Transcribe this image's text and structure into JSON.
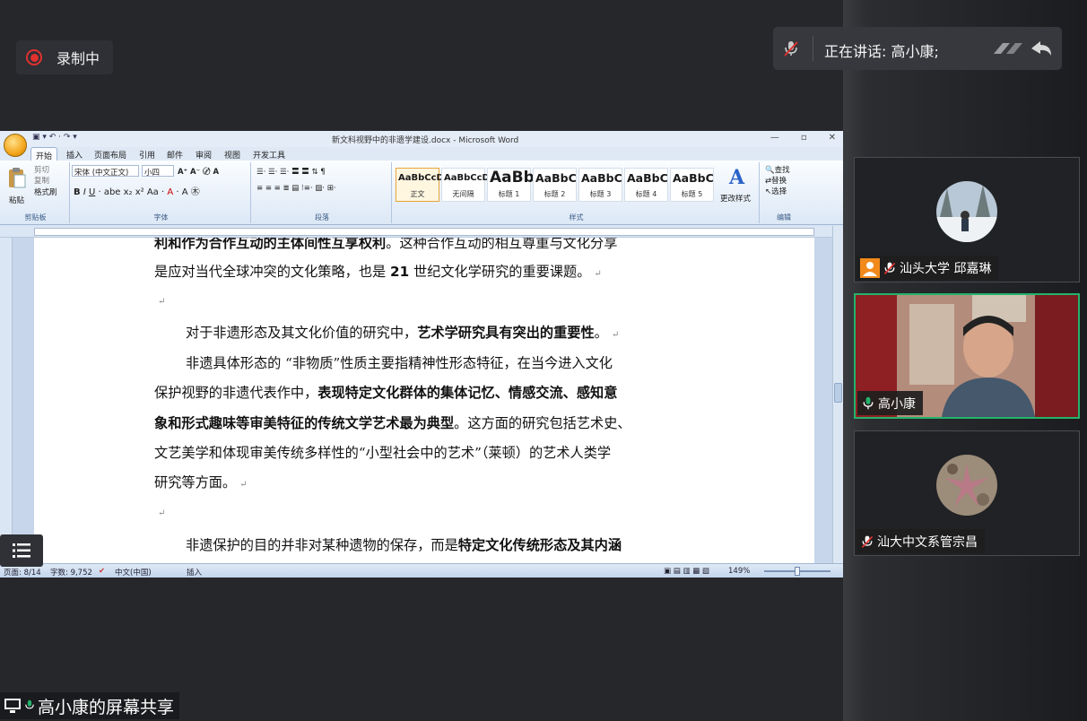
{
  "meeting": {
    "recording_label": "录制中",
    "speaking_label": "正在讲话: 高小康;",
    "share_label": "高小康的屏幕共享",
    "accent_color": "#24b36b",
    "record_color": "#e0312f"
  },
  "participants": [
    {
      "name": "汕头大学 邱嘉琳",
      "mic": "muted",
      "video": false,
      "icon": "person-icon"
    },
    {
      "name": "高小康",
      "mic": "active",
      "video": true,
      "active": true
    },
    {
      "name": "汕大中文系管宗昌",
      "mic": "muted",
      "video": false
    }
  ],
  "word": {
    "title": "新文科视野中的非遗学建设.docx - Microsoft Word",
    "tabs": [
      "开始",
      "插入",
      "页面布局",
      "引用",
      "邮件",
      "审阅",
      "视图",
      "开发工具"
    ],
    "clipboard": {
      "paste": "粘贴",
      "cut": "剪切",
      "copy": "复制",
      "format_painter": "格式刷",
      "group": "剪贴板"
    },
    "font": {
      "name": "宋体 (中文正文)",
      "size": "小四",
      "group": "字体"
    },
    "paragraph_group": "段落",
    "styles": [
      {
        "preview": "AaBbCcD",
        "name": "正文"
      },
      {
        "preview": "AaBbCcD",
        "name": "无间隔"
      },
      {
        "preview": "AaBb",
        "name": "标题 1"
      },
      {
        "preview": "AaBbC",
        "name": "标题 2"
      },
      {
        "preview": "AaBbC",
        "name": "标题 3"
      },
      {
        "preview": "AaBbC",
        "name": "标题 4"
      },
      {
        "preview": "AaBbC",
        "name": "标题 5"
      }
    ],
    "styles_group": "样式",
    "change_styles": "更改样式",
    "editing": {
      "find": "查找",
      "replace": "替换",
      "select": "选择",
      "group": "编辑"
    },
    "document": {
      "l1": {
        "b": "利和作为合作互动的主体间性互享权利",
        "t": "。这种合作互动的相互尊重与文化分享"
      },
      "l2": {
        "t": "是应对当代全球冲突的文化策略，也是 ",
        "b": "21",
        "t2": " 世纪文化学研究的重要课题。"
      },
      "l3": {
        "t": "对于非遗形态及其文化价值的研究中，",
        "b": "艺术学研究具有突出的重要性",
        "t2": "。"
      },
      "l4": {
        "t": "非遗具体形态的 “非物质”性质主要指精神性形态特征，在当今进入文化"
      },
      "l5": {
        "t": "保护视野的非遗代表作中，",
        "b": "表现特定文化群体的集体记忆、情感交流、感知意"
      },
      "l6": {
        "b": "象和形式趣味等审美特征的传统文学艺术最为典型",
        "t": "。这方面的研究包括艺术史、"
      },
      "l7": {
        "t": "文艺美学和体现审美传统多样性的“小型社会中的艺术”（莱顿）的艺术人类学"
      },
      "l8": {
        "t": "研究等方面。"
      },
      "l9": {
        "t": "非遗保护的目的并非对某种遗物的保存，而是",
        "b": "特定文化传统形态及其内涵"
      }
    },
    "status": {
      "page": "页面: 8/14",
      "words": "字数: 9,752",
      "language": "中文(中国)",
      "mode": "插入",
      "zoom": "149%"
    }
  }
}
